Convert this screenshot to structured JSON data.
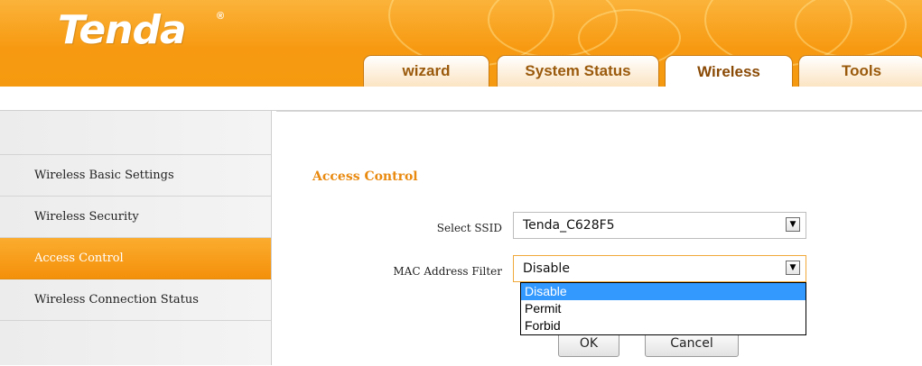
{
  "header": {
    "brand": "Tenda",
    "brand_mark": "®",
    "tabs": [
      {
        "label": "wizard"
      },
      {
        "label": "System Status"
      },
      {
        "label": "Wireless"
      },
      {
        "label": "Tools"
      }
    ],
    "active_tab": "Wireless",
    "brand_color": "#f79a12"
  },
  "sidebar": {
    "items": [
      {
        "label": "Wireless Basic Settings"
      },
      {
        "label": "Wireless Security"
      },
      {
        "label": "Access Control"
      },
      {
        "label": "Wireless Connection Status"
      }
    ],
    "active_item": "Access Control",
    "active_color": "#f69a14"
  },
  "main": {
    "title": "Access Control",
    "ssid": {
      "label": "Select SSID",
      "value": "Tenda_C628F5"
    },
    "mac_filter": {
      "label": "MAC Address Filter",
      "value": "Disable",
      "options": [
        "Disable",
        "Permit",
        "Forbid"
      ],
      "highlighted_option": "Disable"
    },
    "ok_label": "OK",
    "cancel_label": "Cancel",
    "accent_color": "#e98a10"
  }
}
